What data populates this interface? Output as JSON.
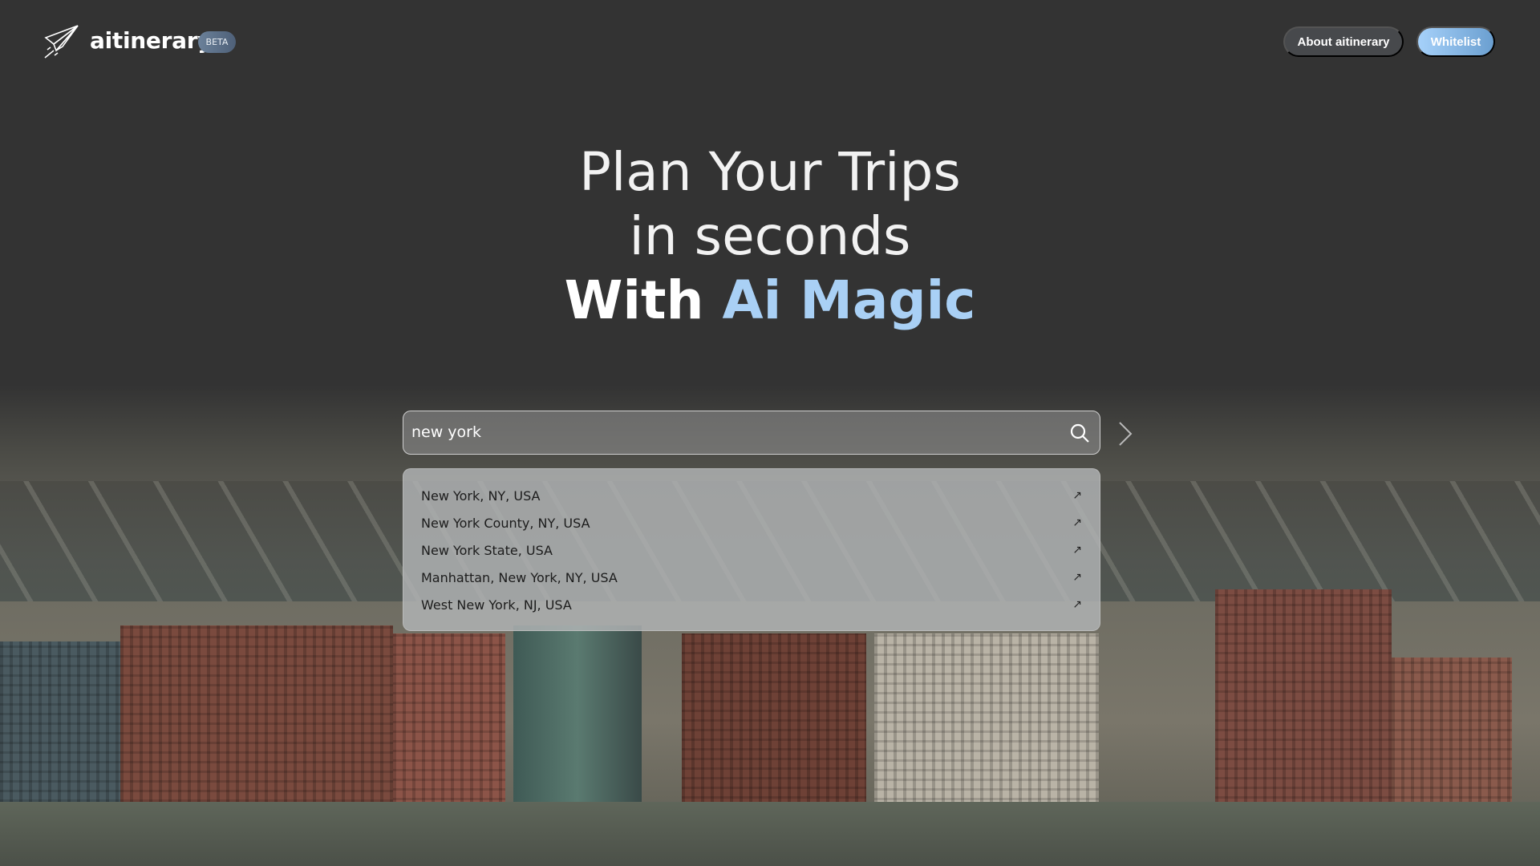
{
  "header": {
    "brand": "aitinerary",
    "badge": "BETA",
    "about_label": "About aitinerary",
    "whitelist_label": "Whitelist"
  },
  "hero": {
    "line1": "Plan Your Trips",
    "line2": "in seconds",
    "line3_prefix": "With",
    "line3_highlight": "Ai Magic"
  },
  "search": {
    "value": "new york"
  },
  "suggestions": [
    {
      "label": "New York, NY, USA"
    },
    {
      "label": "New York County, NY, USA"
    },
    {
      "label": "New York State, USA"
    },
    {
      "label": "Manhattan, New York, NY, USA"
    },
    {
      "label": "West New York, NJ, USA"
    }
  ],
  "colors": {
    "accent": "#a9d0f5",
    "background": "#333333"
  }
}
